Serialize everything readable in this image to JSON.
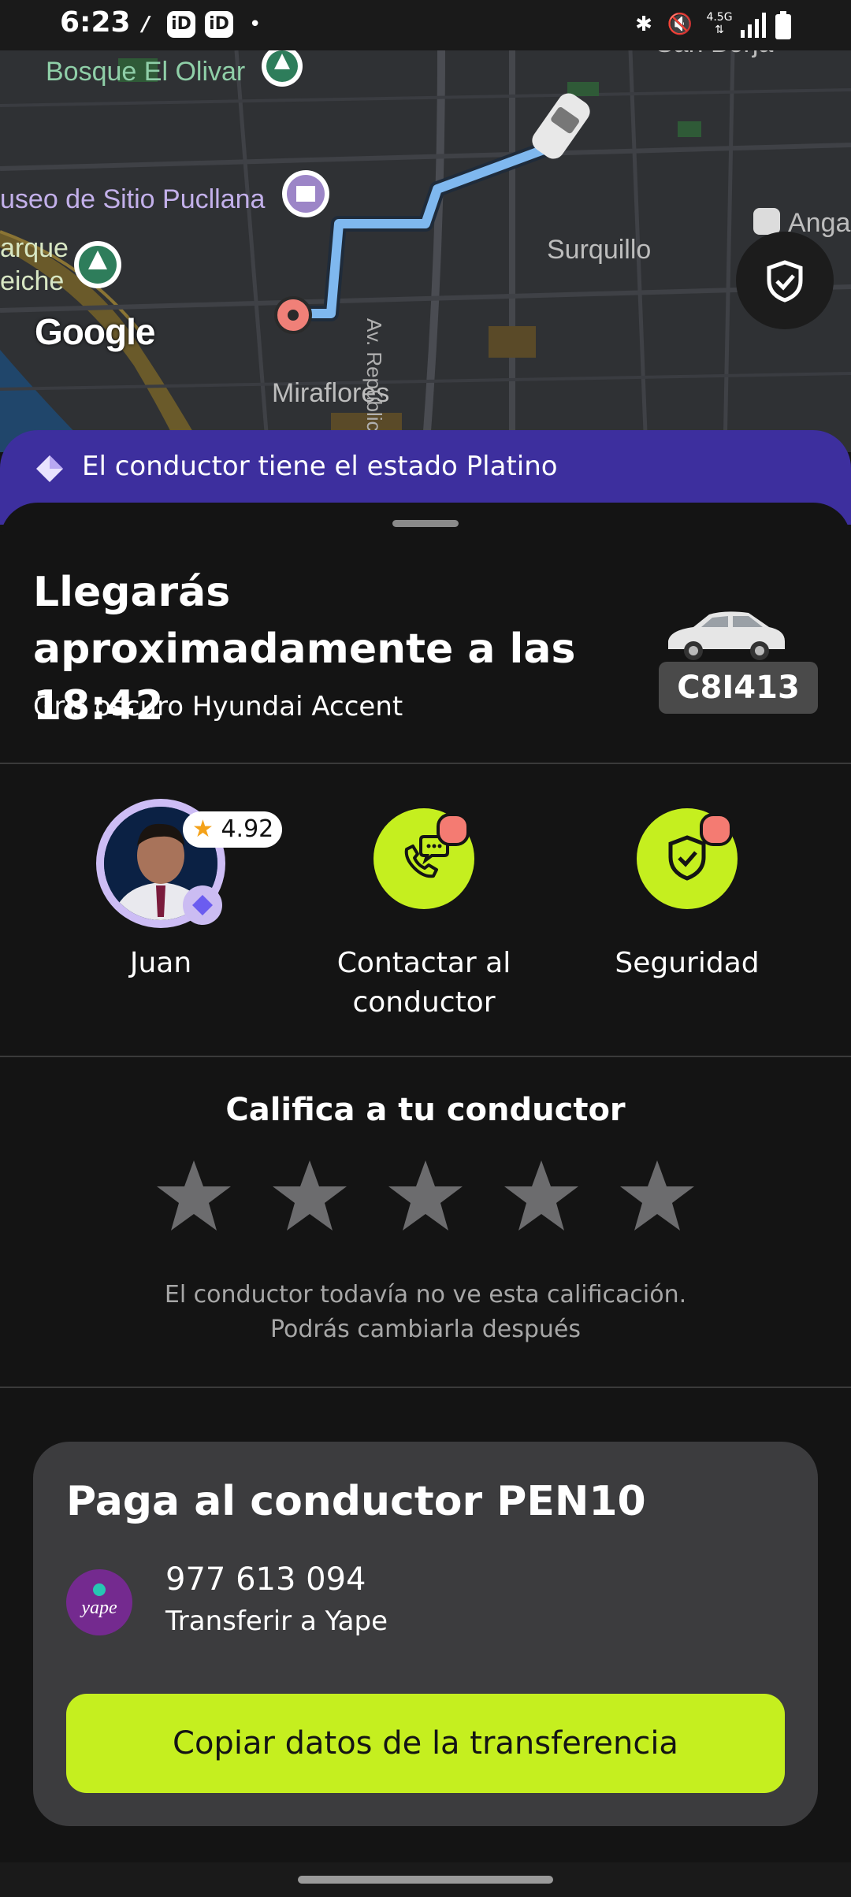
{
  "status_bar": {
    "time": "6:23",
    "left_icons": [
      "app-notification-icon",
      "app-id-icon",
      "app-id-icon",
      "dot-icon"
    ],
    "right_icons": [
      "bluetooth-icon",
      "mute-icon",
      "network-4-5g-icon",
      "signal-icon",
      "battery-icon"
    ],
    "network": "4.5G"
  },
  "map": {
    "labels": {
      "bosque": "Bosque El Olivar",
      "museo": "useo de Sitio Pucllana",
      "parque_a": "arque",
      "parque_b": "eiche",
      "san_borja": "San Borja",
      "surquillo": "Surquillo",
      "avenida": "Av. República de Panar",
      "miraflores": "Miraflores",
      "anga": "Anga"
    },
    "attribution": "Google",
    "route_color": "#7fb8ef"
  },
  "platinum_banner": {
    "text": "El conductor tiene el estado Platino",
    "icon": "diamond-icon"
  },
  "trip": {
    "eta_title": "Llegarás aproximadamente a las 18:42",
    "car_description": "Gris oscuro Hyundai Accent",
    "plate": "C8I413"
  },
  "driver": {
    "name": "Juan",
    "rating": "4.92"
  },
  "actions": {
    "contact_label": "Contactar al conductor",
    "security_label": "Seguridad"
  },
  "rating_section": {
    "title": "Califica a tu conductor",
    "stars": 5,
    "note_line1": "El conductor todavía no ve esta calificación.",
    "note_line2": "Podrás cambiarla después"
  },
  "payment": {
    "title": "Paga al conductor PEN10",
    "phone": "977 613 094",
    "method": "Transferir a Yape",
    "logo_text": "yape",
    "button_label": "Copiar datos de la transferencia"
  },
  "colors": {
    "accent": "#c5ef1f",
    "banner": "#3d2f9e",
    "notification": "#f47b72"
  }
}
